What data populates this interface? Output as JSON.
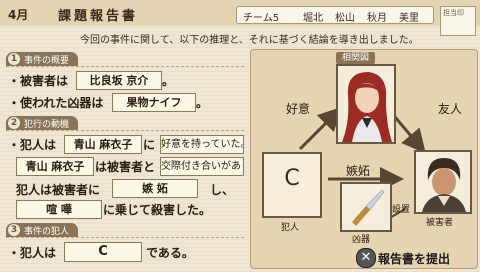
{
  "header": {
    "month": "4月",
    "title": "課題報告書",
    "team": "チーム5",
    "members": [
      "堀北",
      "松山",
      "秋月",
      "美里"
    ],
    "stamp_label": "担当印"
  },
  "intro": "今回の事件に関して、以下の推理と、それに基づく結論を導き出しました。",
  "sections": [
    {
      "num": "1",
      "label": "事件の概要"
    },
    {
      "num": "2",
      "label": "犯行の動機"
    },
    {
      "num": "3",
      "label": "事件の犯人"
    }
  ],
  "overview": {
    "victim_prefix": "・被害者は",
    "victim": "比良坂 京介",
    "victim_suffix": "。",
    "weapon_prefix": "・使われた凶器は",
    "weapon": "果物ナイフ",
    "weapon_suffix": "。"
  },
  "motive": {
    "l1_prefix": "・犯人は",
    "l1_who": "青山 麻衣子",
    "l1_mid": "に",
    "l1_what": "好意を持っていた。",
    "l2_who": "青山 麻衣子",
    "l2_mid": "は被害者と",
    "l2_what": "交際付き合いがあった",
    "l3_prefix": "犯人は被害者に",
    "l3_word": "嫉 妬",
    "l3_suffix": "し、",
    "l4_word": "喧 嘩",
    "l4_suffix": "に乗じて殺害した。"
  },
  "culprit": {
    "prefix": "・犯人は",
    "value": "C",
    "suffix": "である。"
  },
  "diagram": {
    "title": "相関図",
    "culprit_letter": "C",
    "culprit_label": "犯人",
    "victim_label": "被害者",
    "weapon_label": "凶器",
    "rel_love": "好意",
    "rel_friend": "友人",
    "rel_jealous": "嫉妬",
    "rel_set": "設置"
  },
  "footer": {
    "button_icon": "cross-button-icon",
    "submit_label": "報告書を提出"
  },
  "colors": {
    "paper": "#efe7d3",
    "tab": "#8b7456",
    "diagram_bg": "#e6d4b2",
    "arrow": "#5a4630"
  }
}
